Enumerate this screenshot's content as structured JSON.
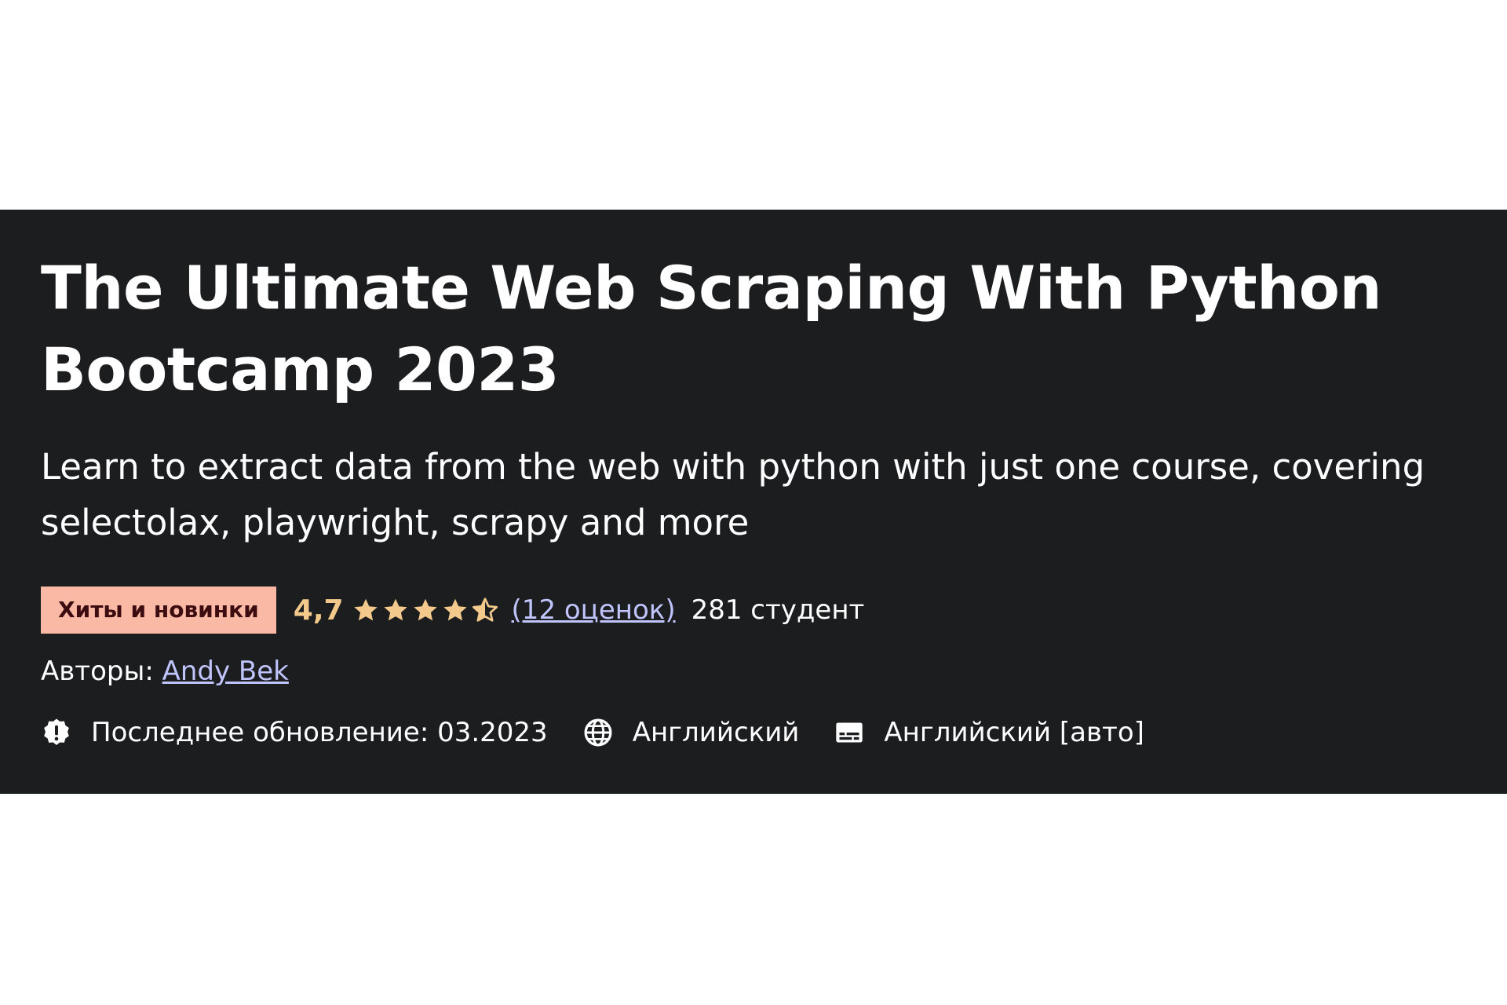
{
  "course": {
    "title": "The Ultimate Web Scraping With Python Bootcamp 2023",
    "subtitle": "Learn to extract data from the web with python with just one course, covering selectolax, playwright, scrapy and more",
    "badge": "Хиты и новинки",
    "rating": {
      "value": "4,7",
      "stars_filled": 4.5,
      "stars_total": 5,
      "count_label": "(12 оценок)"
    },
    "students": "281 студент",
    "authors_label": "Авторы:",
    "author_name": "Andy Bek",
    "last_updated": "Последнее обновление: 03.2023",
    "language": "Английский",
    "captions": "Английский [авто]"
  },
  "icons": {
    "updated": "alert-badge-icon",
    "language": "globe-icon",
    "captions": "captions-icon"
  },
  "colors": {
    "banner_bg": "#1c1d1f",
    "badge_bg": "#f9b9a4",
    "badge_text": "#3d0c11",
    "rating": "#f3ca8c",
    "link": "#c0c4fc",
    "text": "#ffffff"
  }
}
